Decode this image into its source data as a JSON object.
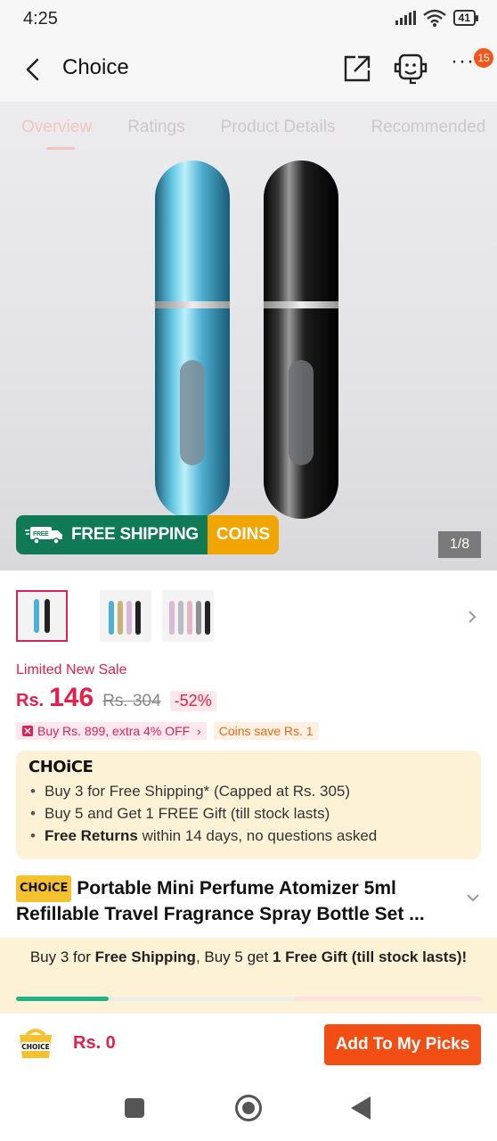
{
  "status_bar": {
    "time": "4:25",
    "battery": "41"
  },
  "header": {
    "title": "Choice",
    "badge_count": "15"
  },
  "tabs": [
    {
      "label": "Overview",
      "active": true
    },
    {
      "label": "Ratings"
    },
    {
      "label": "Product Details"
    },
    {
      "label": "Recommended"
    }
  ],
  "hero": {
    "ship_badge_free": "FREE",
    "ship_label": "FREE SHIPPING",
    "coins_label": "COINS",
    "image_counter": "1/8"
  },
  "price": {
    "sale_label": "Limited New Sale",
    "currency": "Rs.",
    "current": "146",
    "original": "Rs. 304",
    "discount": "-52%"
  },
  "promos": {
    "extra_off": "Buy Rs. 899, extra 4% OFF",
    "coins_save": "Coins save Rs. 1"
  },
  "choice_box": {
    "logo": "CHOiCE",
    "line1": "Buy 3 for  Free Shipping* (Capped at Rs. 305)",
    "line2": "Buy 5 and Get 1 FREE Gift (till stock lasts)",
    "line3_bold": "Free Returns",
    "line3_rest": " within 14 days, no questions asked"
  },
  "product": {
    "tag": "CHOiCE",
    "title": "Portable Mini Perfume Atomizer 5ml Refillable Travel Fragrance Spray Bottle Set ..."
  },
  "ship_promo": {
    "part1": "Buy 3 for ",
    "bold1": "Free Shipping",
    "part2": ", Buy 5 get ",
    "bold2": "1 Free Gift (till stock lasts)!",
    "progress_fraction": 0.2
  },
  "action_bar": {
    "icon_label": "CHOICE",
    "amount": "Rs. 0",
    "add_button": "Add To My Picks"
  },
  "colors": {
    "accent_red": "#e2204a",
    "button_orange": "#f24d12",
    "ship_green": "#0f7a55",
    "coins_yellow": "#f0a500",
    "choice_bg": "#fdf2d6"
  }
}
